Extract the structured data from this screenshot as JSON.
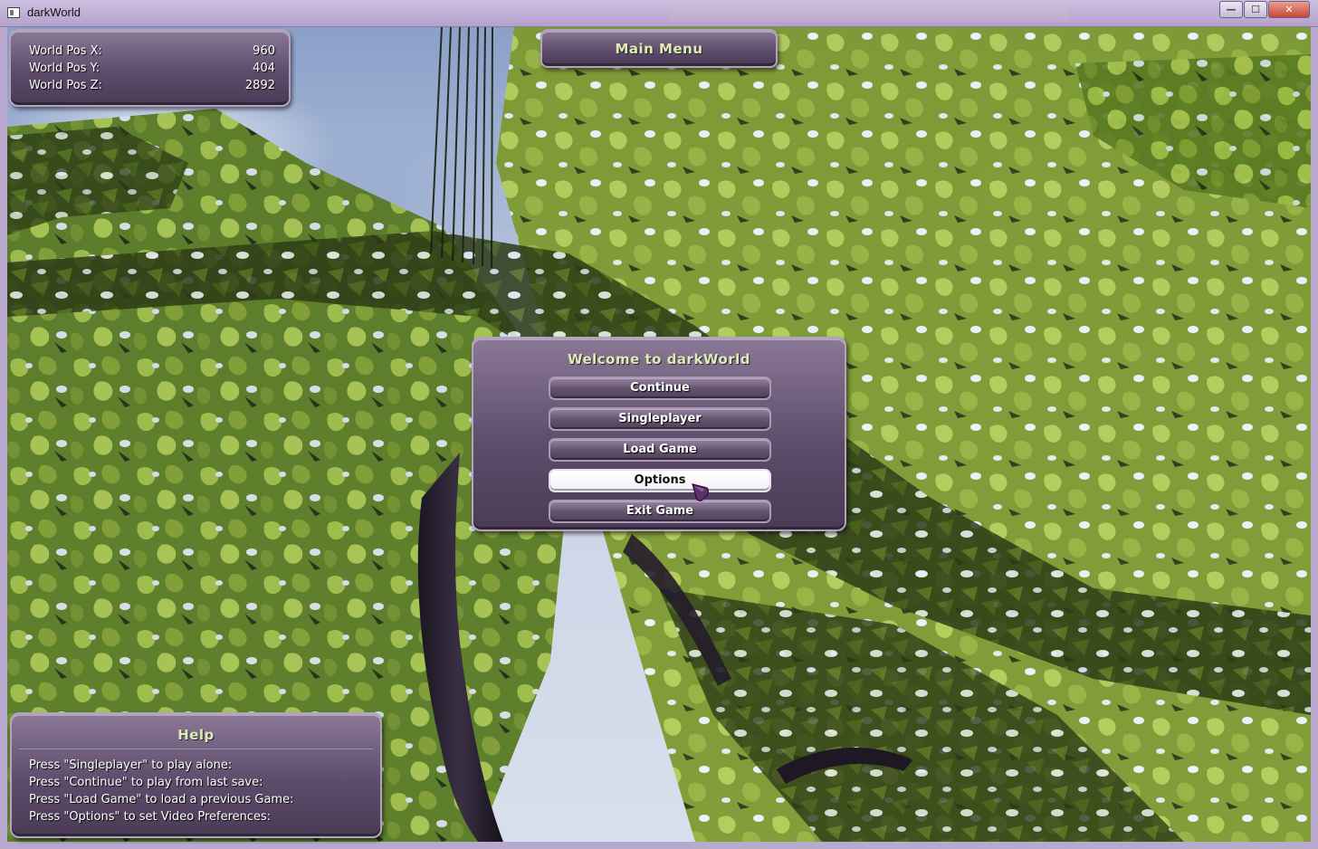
{
  "window": {
    "title": "darkWorld",
    "minimize_glyph": "—",
    "maximize_glyph": "☐",
    "close_glyph": "✕"
  },
  "hud": {
    "position": {
      "rows": [
        {
          "label": "World Pos X:",
          "value": "960"
        },
        {
          "label": "World Pos Y:",
          "value": "404"
        },
        {
          "label": "World Pos Z:",
          "value": "2892"
        }
      ]
    },
    "main_menu_title": "Main Menu"
  },
  "welcome": {
    "title": "Welcome to darkWorld",
    "buttons": [
      {
        "label": "Continue"
      },
      {
        "label": "Singleplayer"
      },
      {
        "label": "Load Game"
      },
      {
        "label": "Options",
        "state": "hovered"
      },
      {
        "label": "Exit Game"
      }
    ]
  },
  "help": {
    "title": "Help",
    "lines": [
      "Press \"Singleplayer\" to play alone:",
      "Press \"Continue\" to play from last save:",
      "Press \"Load Game\" to load a previous Game:",
      "Press \"Options\" to set Video Preferences:"
    ]
  },
  "colors": {
    "panel": "#5d4c6a",
    "panel_border": "#b3a3bf",
    "title_text": "#dcecb4",
    "foliage_light": "#8fae3a",
    "foliage_dark": "#1f2a12",
    "window_frame": "#b9a9cf"
  },
  "icons": {
    "cursor": "purple-arrow-cursor-icon",
    "app": "window-app-icon"
  }
}
